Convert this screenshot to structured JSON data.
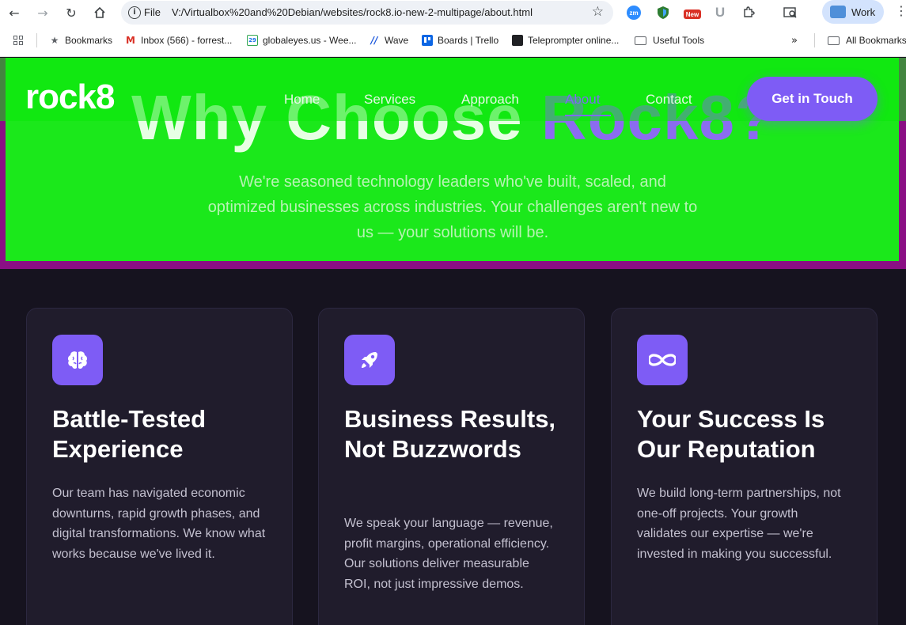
{
  "browser": {
    "url_scheme_label": "File",
    "url": "V:/Virtualbox%20and%20Debian/websites/rock8.io-new-2-multipage/about.html",
    "profile_label": "Work",
    "extensions": [
      "zoom-extension",
      "shield-extension",
      "new-badge-extension",
      "u-extension",
      "puzzle-extension",
      "search-tab-extension"
    ],
    "new_badge_label": "New",
    "zoom_ext_label": "zm",
    "bookmarks": [
      {
        "label": "Bookmarks",
        "icon": "star-icon"
      },
      {
        "label": "Inbox (566) - forrest...",
        "icon": "gmail-icon"
      },
      {
        "label": "globaleyes.us - Wee...",
        "icon": "calendar-icon"
      },
      {
        "label": "Wave",
        "icon": "wave-icon"
      },
      {
        "label": "Boards | Trello",
        "icon": "trello-icon"
      },
      {
        "label": "Teleprompter online...",
        "icon": "teleprompter-icon"
      },
      {
        "label": "Useful Tools",
        "icon": "folder-icon"
      }
    ],
    "all_bookmarks_label": "All Bookmarks",
    "calendar_icon_label": "29"
  },
  "site": {
    "logo": "rock8",
    "nav": [
      {
        "label": "Home",
        "active": false
      },
      {
        "label": "Services",
        "active": false
      },
      {
        "label": "Approach",
        "active": false
      },
      {
        "label": "About",
        "active": true
      },
      {
        "label": "Contact",
        "active": false
      }
    ],
    "cta_label": "Get in Touch"
  },
  "hero": {
    "title_main": "Why Choose ",
    "title_accent": "Rock8?",
    "subtitle": "We're seasoned technology leaders who've built, scaled, and optimized businesses across industries. Your challenges aren't new to us — your solutions will be."
  },
  "cards": [
    {
      "icon": "brain-icon",
      "title": "Battle-Tested Experience",
      "text": "Our team has navigated economic downturns, rapid growth phases, and digital transformations. We know what works because we've lived it."
    },
    {
      "icon": "rocket-icon",
      "title": "Business Results, Not Buzzwords",
      "text": "We speak your language — revenue, profit margins, operational efficiency. Our solutions deliver measurable ROI, not just impressive demos."
    },
    {
      "icon": "infinity-icon",
      "title": "Your Success Is Our Reputation",
      "text": "We build long-term partnerships, not one-off projects. Your growth validates our expertise — we're invested in making you successful."
    }
  ],
  "colors": {
    "accent": "#7e5cf5",
    "hero_background": "#1be81b",
    "hero_border": "#8a0f84",
    "page_background": "#16131f",
    "card_background": "#201c2c"
  }
}
